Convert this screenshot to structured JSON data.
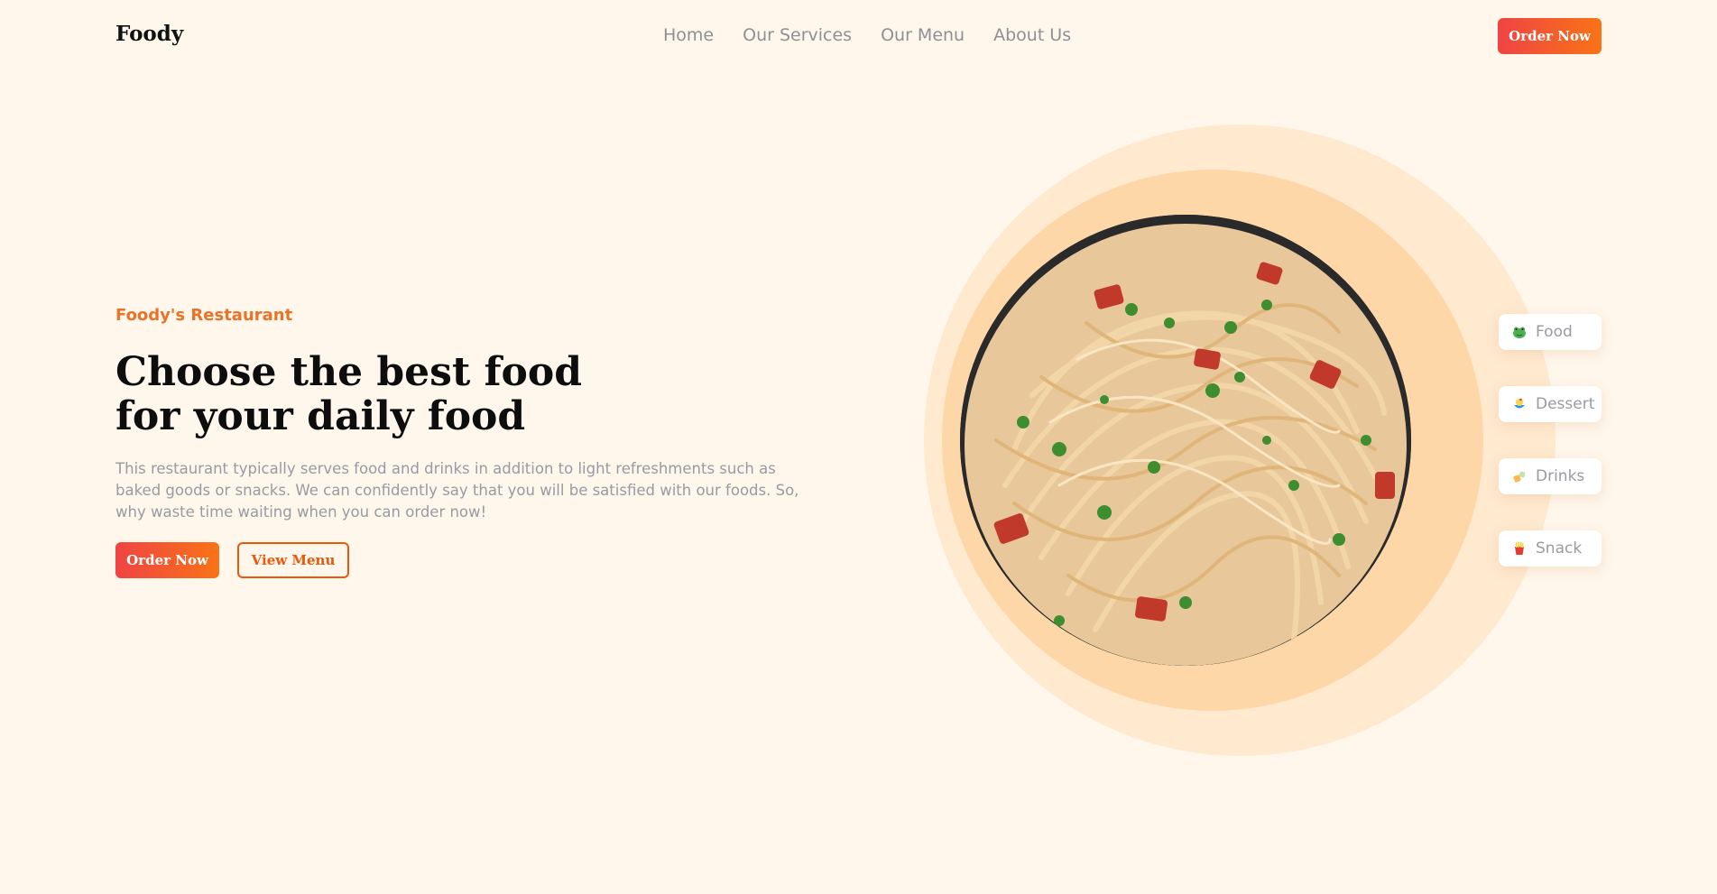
{
  "header": {
    "logo": "Foody",
    "nav": [
      "Home",
      "Our Services",
      "Our Menu",
      "About Us"
    ],
    "cta": "Order Now"
  },
  "hero": {
    "eyebrow": "Foody's Restaurant",
    "headline_line1": "Choose the best food",
    "headline_line2": "for your daily food",
    "description": "This restaurant typically serves food and drinks in addition to light refreshments such as baked goods or snacks. We can confidently say that you will be satisfied with our foods. So, why waste time waiting when you can order now!",
    "primary_button": "Order Now",
    "secondary_button": "View Menu"
  },
  "categories": [
    {
      "label": "Food",
      "icon": "frog-icon"
    },
    {
      "label": "Dessert",
      "icon": "dessert-icon"
    },
    {
      "label": "Drinks",
      "icon": "drinks-icon"
    },
    {
      "label": "Snack",
      "icon": "snack-icon"
    }
  ],
  "colors": {
    "background": "#fff6ec",
    "accent": "#ea580c",
    "accent_gradient_start": "#ef4444",
    "accent_gradient_end": "#f97316",
    "ring_outer": "#ffe9cf",
    "ring_mid": "#fed7a8"
  }
}
